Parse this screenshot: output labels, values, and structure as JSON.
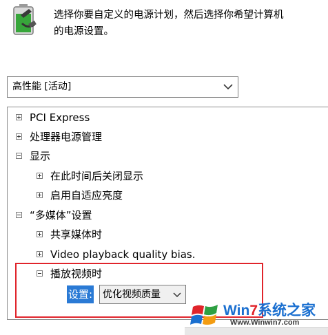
{
  "header": {
    "icon": "battery-plug-icon",
    "description_line1": "选择你要自定义的电源计划，然后选择你希望计算机",
    "description_line2": "的电源设置。"
  },
  "plan_select": {
    "selected": "高性能 [活动]",
    "icon": "chevron-down-icon"
  },
  "tree": {
    "items": [
      {
        "label": "PCI Express",
        "expander": "plus",
        "level": 0
      },
      {
        "label": "处理器电源管理",
        "expander": "plus",
        "level": 0
      },
      {
        "label": "显示",
        "expander": "minus",
        "level": 0
      },
      {
        "label": "在此时间后关闭显示",
        "expander": "plus",
        "level": 1
      },
      {
        "label": "启用自适应亮度",
        "expander": "plus",
        "level": 1
      },
      {
        "label": "“多媒体”设置",
        "expander": "minus",
        "level": 0
      },
      {
        "label": "共享媒体时",
        "expander": "plus",
        "level": 1
      },
      {
        "label": "Video playback quality bias.",
        "expander": "plus",
        "level": 1
      },
      {
        "label": "播放视频时",
        "expander": "minus",
        "level": 1
      }
    ],
    "setting": {
      "label": "设置:",
      "value": "优化视频质量"
    }
  },
  "watermark": {
    "title_prefix": "Win",
    "title_digit": "7",
    "title_suffix": "系统之家",
    "url": "Www.Winwin7.com",
    "colors": {
      "blue": "#1a6fd0",
      "red": "#e0242b",
      "orange": "#f39c12",
      "green": "#2ea043"
    }
  },
  "highlight_color": "#e0242b",
  "accent": "#2a7ad5"
}
